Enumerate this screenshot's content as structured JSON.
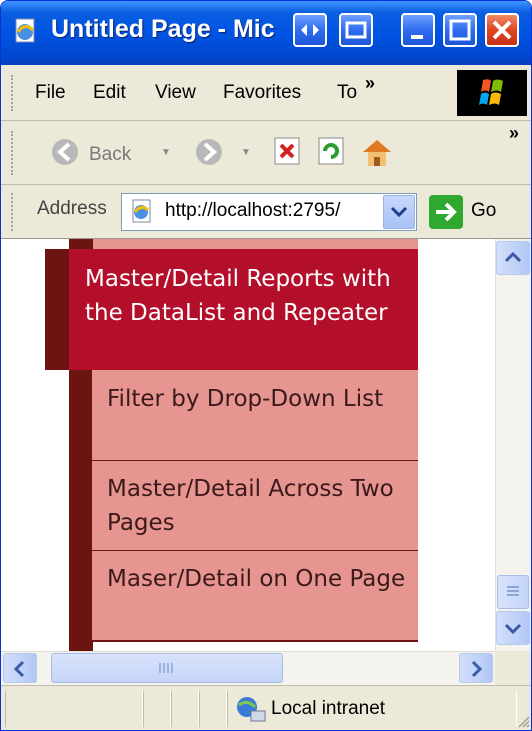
{
  "window": {
    "title": "Untitled Page - Mic"
  },
  "menubar": {
    "items": [
      "File",
      "Edit",
      "View",
      "Favorites",
      "To"
    ],
    "overflow": "»"
  },
  "toolbar": {
    "back_label": "Back",
    "overflow": "»"
  },
  "address": {
    "label": "Address",
    "url": "http://localhost:2795/",
    "go_label": "Go"
  },
  "content": {
    "active_item": "Master/Detail Reports with the DataList and Repeater",
    "sub_items": [
      "Filter by Drop-Down List",
      "Master/Detail Across Two Pages",
      "Maser/Detail on One Page"
    ]
  },
  "status": {
    "zone": "Local intranet"
  },
  "colors": {
    "active_bg": "#b30e2a",
    "sub_bg": "#e69590",
    "dark_strip": "#6b1412",
    "titlebar": "#0054e3"
  }
}
